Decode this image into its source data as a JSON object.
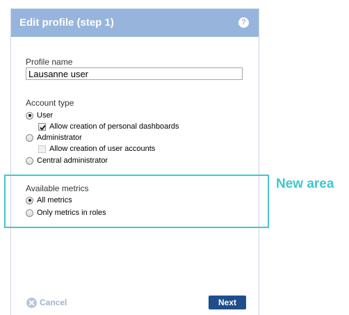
{
  "dialog": {
    "title": "Edit profile (step 1)",
    "help_glyph": "?"
  },
  "profile_name": {
    "label": "Profile name",
    "value": "Lausanne user"
  },
  "account_type": {
    "label": "Account type",
    "options": [
      {
        "label": "User",
        "checked": true
      },
      {
        "label": "Allow creation of personal dashboards",
        "checked": true,
        "kind": "checkbox"
      },
      {
        "label": "Administrator",
        "checked": false
      },
      {
        "label": "Allow creation of user accounts",
        "checked": false,
        "kind": "checkbox",
        "disabled": true
      },
      {
        "label": "Central administrator",
        "checked": false
      }
    ]
  },
  "available_metrics": {
    "label": "Available metrics",
    "options": [
      {
        "label": "All metrics",
        "checked": true
      },
      {
        "label": "Only metrics in roles",
        "checked": false
      }
    ]
  },
  "footer": {
    "cancel_label": "Cancel",
    "next_label": "Next"
  },
  "annotation": {
    "label": "New area"
  },
  "colors": {
    "header": "#97b5dc",
    "next_button": "#1f4e8c",
    "highlight": "#3fc7cc",
    "cancel": "#9fb3cf"
  },
  "icons": {
    "help": "help-icon",
    "cancel": "cancel-x-circle-icon",
    "checkmark": "checkmark-icon"
  }
}
